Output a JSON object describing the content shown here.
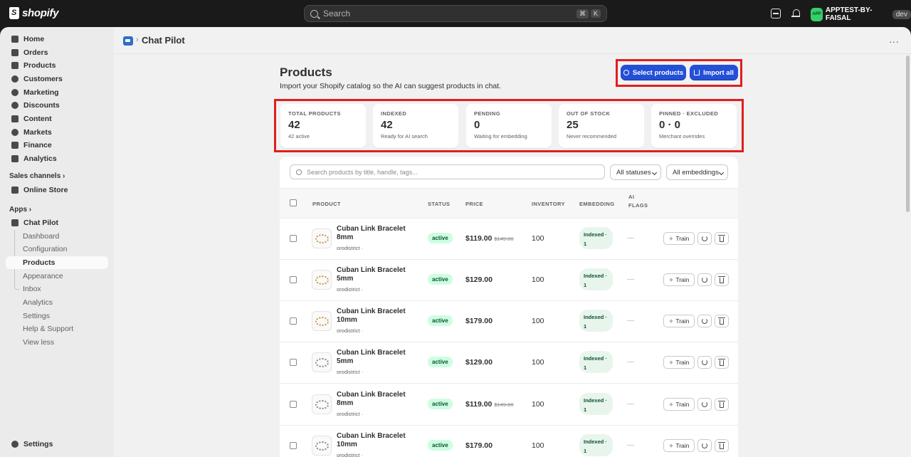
{
  "topbar": {
    "logo_text": "shopify",
    "search_placeholder": "Search",
    "shortcut_keys": [
      "⌘",
      "K"
    ],
    "store_avatar": "APP",
    "store_name": "APPTEST-BY-FAISAL",
    "store_badge": "dev"
  },
  "sidebar": {
    "items": [
      {
        "label": "Home",
        "icon": "home-icon"
      },
      {
        "label": "Orders",
        "icon": "orders-icon"
      },
      {
        "label": "Products",
        "icon": "tag-icon"
      },
      {
        "label": "Customers",
        "icon": "person-icon"
      },
      {
        "label": "Marketing",
        "icon": "target-icon"
      },
      {
        "label": "Discounts",
        "icon": "discount-icon"
      },
      {
        "label": "Content",
        "icon": "content-icon"
      },
      {
        "label": "Markets",
        "icon": "globe-icon"
      },
      {
        "label": "Finance",
        "icon": "bank-icon"
      },
      {
        "label": "Analytics",
        "icon": "chart-icon"
      }
    ],
    "sales_channels_label": "Sales channels",
    "online_store_label": "Online Store",
    "apps_label": "Apps",
    "app_name": "Chat Pilot",
    "app_subitems": [
      "Dashboard",
      "Configuration",
      "Products",
      "Appearance",
      "Inbox",
      "Analytics",
      "Settings",
      "Help & Support",
      "View less"
    ],
    "settings_label": "Settings"
  },
  "app_header": {
    "title": "Chat Pilot"
  },
  "page": {
    "title": "Products",
    "subtitle": "Import your Shopify catalog so the AI can suggest products in chat.",
    "select_products_label": "Select products",
    "import_all_label": "Import all"
  },
  "stats": [
    {
      "label": "Total products",
      "value": "42",
      "hint": "42 active"
    },
    {
      "label": "Indexed",
      "value": "42",
      "hint": "Ready for AI search"
    },
    {
      "label": "Pending",
      "value": "0",
      "hint": "Waiting for embedding"
    },
    {
      "label": "Out of stock",
      "value": "25",
      "hint": "Never recommended"
    },
    {
      "label": "Pinned · Excluded",
      "value": "0 · 0",
      "hint": "Merchant overrides"
    }
  ],
  "table": {
    "search_placeholder": "Search products by title, handle, tags...",
    "status_filter": "All statuses",
    "embedding_filter": "All embeddings",
    "columns": {
      "product": "Product",
      "status": "Status",
      "price": "Price",
      "inventory": "Inventory",
      "embedding": "Embedding",
      "ai_flags": "AI Flags"
    },
    "train_label": "Train",
    "rows": [
      {
        "name": "Cuban Link Bracelet 8mm",
        "vendor": "orodistrict ·",
        "status": "active",
        "price": "$119.00",
        "compare_price": "$149.00",
        "inventory": "100",
        "embedding": "Indexed · 1",
        "ai_flags": "—",
        "color": "gold"
      },
      {
        "name": "Cuban Link Bracelet 5mm",
        "vendor": "orodistrict ·",
        "status": "active",
        "price": "$129.00",
        "compare_price": "",
        "inventory": "100",
        "embedding": "Indexed · 1",
        "ai_flags": "—",
        "color": "gold"
      },
      {
        "name": "Cuban Link Bracelet 10mm",
        "vendor": "orodistrict ·",
        "status": "active",
        "price": "$179.00",
        "compare_price": "",
        "inventory": "100",
        "embedding": "Indexed · 1",
        "ai_flags": "—",
        "color": "gold"
      },
      {
        "name": "Cuban Link Bracelet 5mm",
        "vendor": "orodistrict ·",
        "status": "active",
        "price": "$129.00",
        "compare_price": "",
        "inventory": "100",
        "embedding": "Indexed · 1",
        "ai_flags": "—",
        "color": "silver"
      },
      {
        "name": "Cuban Link Bracelet 8mm",
        "vendor": "orodistrict ·",
        "status": "active",
        "price": "$119.00",
        "compare_price": "$149.00",
        "inventory": "100",
        "embedding": "Indexed · 1",
        "ai_flags": "—",
        "color": "silver"
      },
      {
        "name": "Cuban Link Bracelet 10mm",
        "vendor": "orodistrict ·",
        "status": "active",
        "price": "$179.00",
        "compare_price": "",
        "inventory": "100",
        "embedding": "Indexed · 1",
        "ai_flags": "—",
        "color": "silver"
      }
    ]
  },
  "colors": {
    "primary_button": "#2450d8",
    "highlight": "#e01e1e",
    "active_badge": "#cdfee1",
    "indexed_badge": "#e8f5ec"
  }
}
